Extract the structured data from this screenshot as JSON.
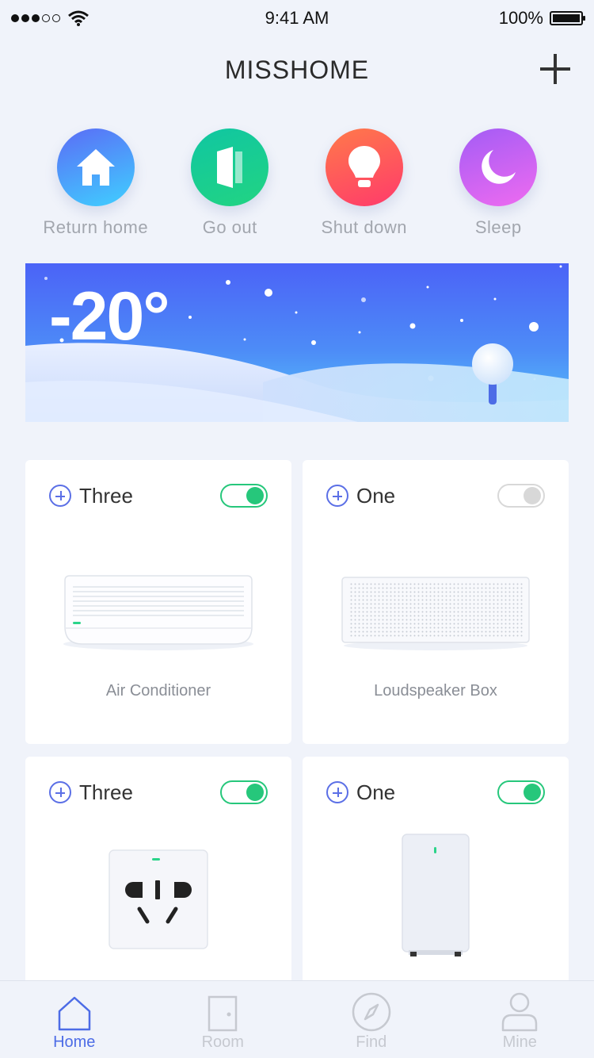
{
  "status_bar": {
    "time": "9:41 AM",
    "battery": "100%"
  },
  "nav": {
    "title": "MISSHOME"
  },
  "scenes": [
    {
      "label": "Return home",
      "icon": "home-icon",
      "color_from": "#3fd0ff",
      "color_to": "#5b6cf6"
    },
    {
      "label": "Go out",
      "icon": "door-icon",
      "color_from": "#22d482",
      "color_to": "#10c6a2"
    },
    {
      "label": "Shut down",
      "icon": "bulb-icon",
      "color_from": "#ff7a4a",
      "color_to": "#ff3a6b"
    },
    {
      "label": "Sleep",
      "icon": "moon-icon",
      "color_from": "#ef6bf0",
      "color_to": "#a35cf5"
    }
  ],
  "weather": {
    "temperature": "-20°"
  },
  "devices": [
    {
      "room": "Three",
      "on": true,
      "name": "Air Conditioner",
      "icon": "air-conditioner-icon"
    },
    {
      "room": "One",
      "on": false,
      "name": "Loudspeaker Box",
      "icon": "speaker-icon"
    },
    {
      "room": "Three",
      "on": true,
      "name": "",
      "icon": "socket-icon"
    },
    {
      "room": "One",
      "on": true,
      "name": "",
      "icon": "router-icon"
    }
  ],
  "tabs": [
    {
      "label": "Home",
      "icon": "home-outline-icon",
      "active": true
    },
    {
      "label": "Room",
      "icon": "door-outline-icon",
      "active": false
    },
    {
      "label": "Find",
      "icon": "compass-icon",
      "active": false
    },
    {
      "label": "Mine",
      "icon": "user-icon",
      "active": false
    }
  ],
  "colors": {
    "accent": "#4d6ce6",
    "toggle_on": "#26c77b",
    "toggle_off": "#d8d8d8",
    "background": "#f0f3fa"
  }
}
